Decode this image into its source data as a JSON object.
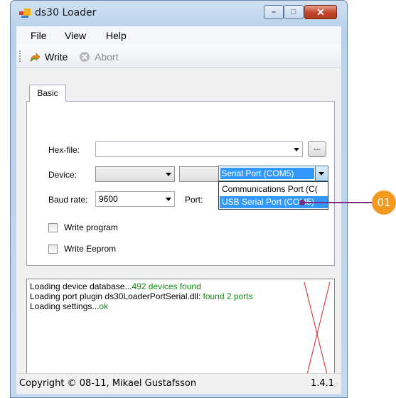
{
  "window": {
    "title": "ds30 Loader",
    "controls": {
      "minimize": "–",
      "maximize": "□",
      "close": "✕"
    },
    "accent": "#c1442b"
  },
  "menu": {
    "items": [
      "File",
      "View",
      "Help"
    ]
  },
  "toolbar": {
    "write": {
      "label": "Write",
      "icon": "write-arrow-icon"
    },
    "abort": {
      "label": "Abort",
      "icon": "abort-x-icon"
    }
  },
  "tabs": [
    {
      "label": "Basic",
      "selected": true
    }
  ],
  "form": {
    "hexfile": {
      "label": "Hex-file:",
      "value": "",
      "browse_label": "..."
    },
    "device": {
      "label": "Device:",
      "family_value": "",
      "model_value": ""
    },
    "baud": {
      "label": "Baud rate:",
      "value": "9600"
    },
    "port": {
      "label": "Port:",
      "value": "USB Serial Port (COM5)",
      "visible_value": "B Serial Port (COM5)",
      "options": [
        "Communications Port (C(",
        "USB Serial Port (COM5)"
      ],
      "highlighted_index": 1
    },
    "write_program": {
      "label": "Write program",
      "checked": false
    },
    "write_eeprom": {
      "label": "Write Eeprom",
      "checked": false
    }
  },
  "log": {
    "lines": [
      {
        "text": "Loading device database...",
        "result": "492 devices found"
      },
      {
        "text": "Loading port plugin ds30LoaderPortSerial.dll: ",
        "result": "found 2 ports"
      },
      {
        "text": "Loading settings...",
        "result": "ok"
      }
    ]
  },
  "status": {
    "copyright": "Copyright © 08-11, Mikael Gustafsson",
    "version": "1.4.1"
  },
  "callout": {
    "label": "01",
    "color": "#f29a1f",
    "line_color": "#7a2a82"
  }
}
